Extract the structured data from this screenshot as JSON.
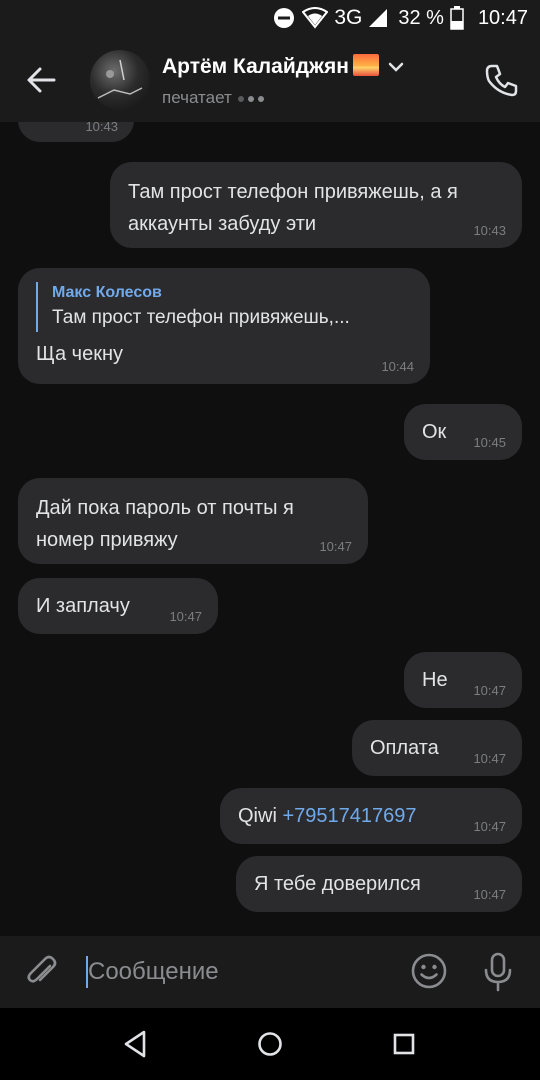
{
  "status": {
    "network": "3G",
    "battery": "32 %",
    "time": "10:47"
  },
  "header": {
    "name": "Артём Калайджян",
    "status": "печатает"
  },
  "messages": {
    "m0_time": "10:43",
    "m1_text": "Там прост телефон привяжешь, а я аккаунты забуду эти",
    "m1_time": "10:43",
    "m2_reply_name": "Макс Колесов",
    "m2_reply_text": "Там прост телефон привяжешь,...",
    "m2_text": "Ща чекну",
    "m2_time": "10:44",
    "m3_text": "Ок",
    "m3_time": "10:45",
    "m4_text": "Дай пока пароль от почты я номер привяжу",
    "m4_time": "10:47",
    "m5_text": "И заплачу",
    "m5_time": "10:47",
    "m6_text": "Не",
    "m6_time": "10:47",
    "m7_text": "Оплата",
    "m7_time": "10:47",
    "m8_prefix": "Qiwi",
    "m8_link": "+79517417697",
    "m8_time": "10:47",
    "m9_text": "Я тебе доверился",
    "m9_time": "10:47"
  },
  "composer": {
    "placeholder": "Сообщение"
  },
  "colors": {
    "accent": "#71aaeb",
    "bubble": "#2b2b2d",
    "background": "#0f0f10",
    "bar": "#1b1b1b"
  },
  "icons": [
    "back-arrow-icon",
    "chevron-down-icon",
    "phone-icon",
    "paperclip-icon",
    "smile-icon",
    "microphone-icon",
    "nav-back-icon",
    "nav-home-icon",
    "nav-recents-icon"
  ]
}
